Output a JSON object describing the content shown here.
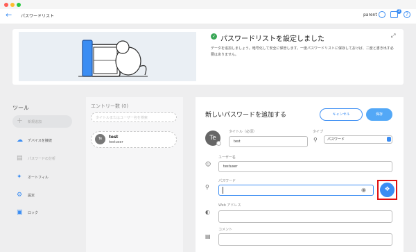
{
  "app": {
    "title": "パスワードリスト",
    "user": "parent",
    "badge_count": "3"
  },
  "banner": {
    "title": "パスワードリストを設定しました",
    "body": "データを追加しましょう。暗号化して安全に保管します。一度パスワードリストに保存しておけば、二度と書き出す必要はありません。"
  },
  "sidebar": {
    "title": "ツール",
    "items": [
      {
        "label": "新規追加",
        "icon": "plus-icon"
      },
      {
        "label": "デバイスを接続",
        "icon": "cloud-upload-icon"
      },
      {
        "label": "パスワードの分析",
        "icon": "analysis-icon"
      },
      {
        "label": "オートフィル",
        "icon": "magic-wand-icon"
      },
      {
        "label": "設定",
        "icon": "gear-icon"
      },
      {
        "label": "ロック",
        "icon": "lock-icon"
      }
    ]
  },
  "entries": {
    "title": "エントリー数 (0)",
    "search_placeholder": "タイトルまたはユーザー名を検索",
    "items": [
      {
        "avatar": "Te",
        "name": "test",
        "username": "testuser"
      }
    ]
  },
  "form": {
    "title": "新しいパスワードを追加する",
    "cancel_label": "キャンセル",
    "save_label": "保存",
    "avatar": "Te",
    "title_label": "タイトル（必須）",
    "title_value": "test",
    "type_label": "タイプ",
    "type_value": "パスワード",
    "username_label": "ユーザー名",
    "username_value": "testuser",
    "password_label": "パスワード",
    "password_value": "",
    "url_label": "Web アドレス",
    "url_value": "",
    "comment_label": "コメント",
    "comment_value": ""
  },
  "colors": {
    "accent": "#3b8df3",
    "highlight": "#e01010",
    "success": "#3aa757"
  }
}
